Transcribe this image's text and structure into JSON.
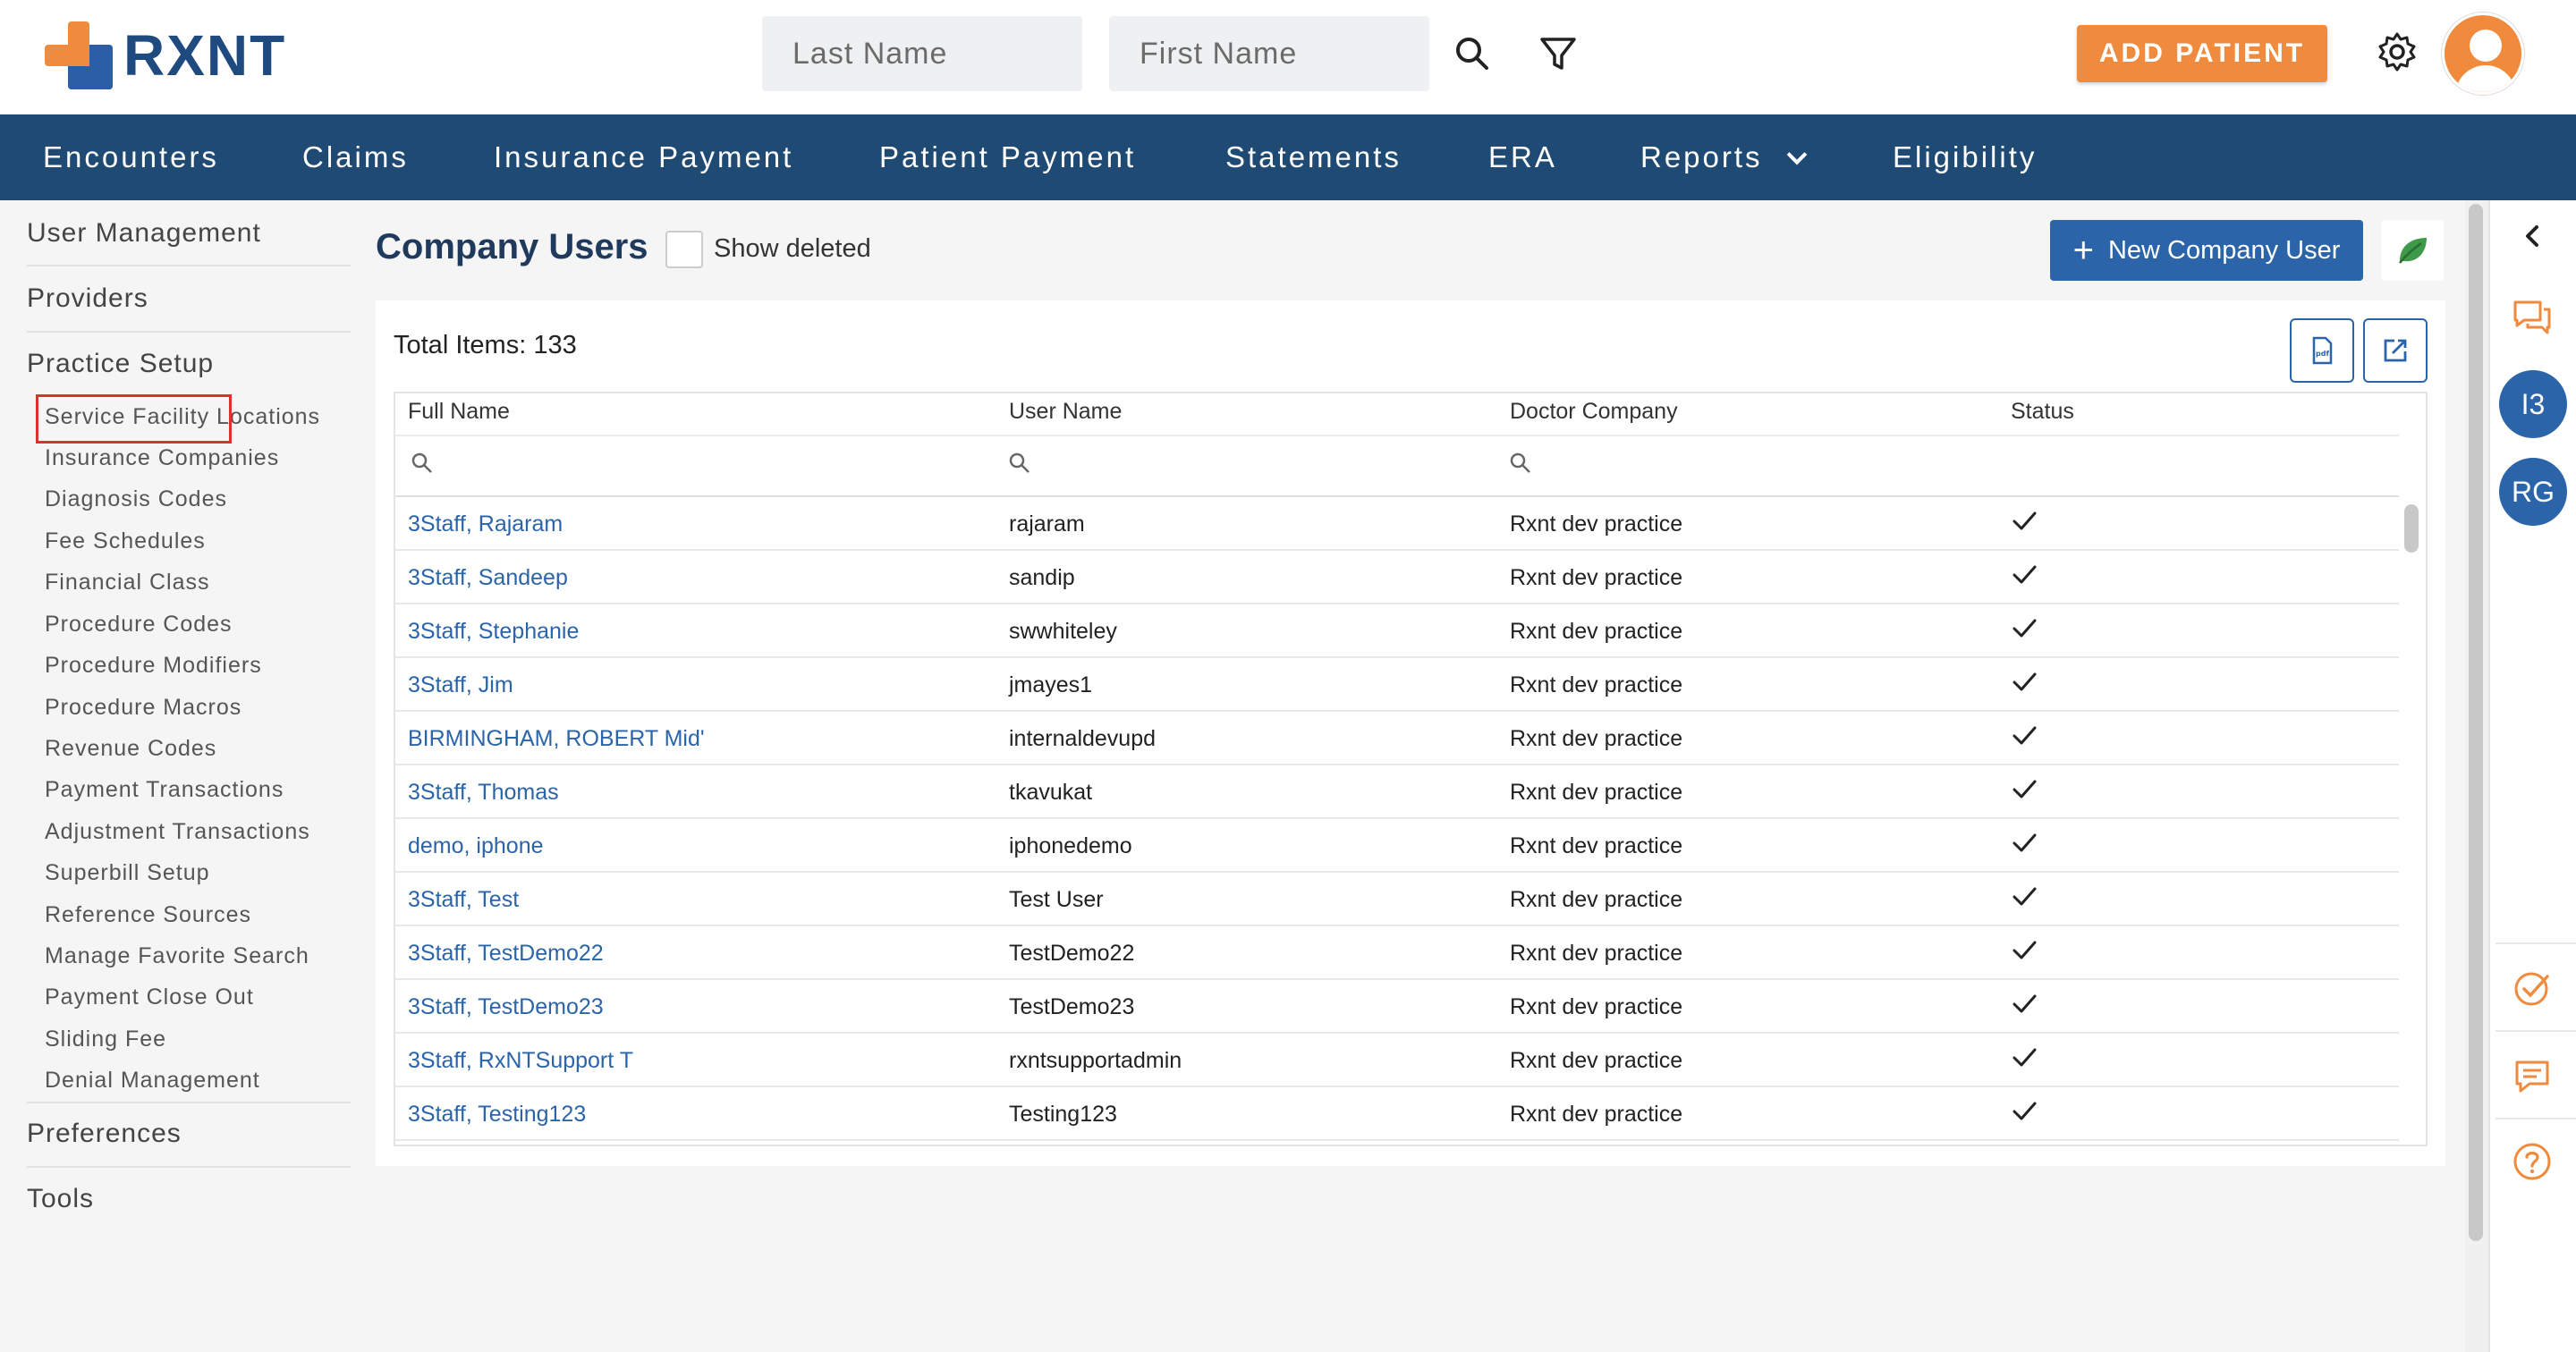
{
  "header": {
    "logo_text": "RXNT",
    "last_name_placeholder": "Last Name",
    "first_name_placeholder": "First Name",
    "add_patient_label": "ADD PATIENT"
  },
  "nav": {
    "items": [
      "Encounters",
      "Claims",
      "Insurance Payment",
      "Patient Payment",
      "Statements",
      "ERA",
      "Reports",
      "Eligibility"
    ]
  },
  "sidebar": {
    "sections": [
      "User Management",
      "Providers",
      "Practice Setup",
      "Preferences",
      "Tools"
    ],
    "practice_setup_items": [
      "Service Facility Locations",
      "Insurance Companies",
      "Diagnosis Codes",
      "Fee Schedules",
      "Financial Class",
      "Procedure Codes",
      "Procedure Modifiers",
      "Procedure Macros",
      "Revenue Codes",
      "Payment Transactions",
      "Adjustment Transactions",
      "Superbill Setup",
      "Reference Sources",
      "Manage Favorite Search",
      "Payment Close Out",
      "Sliding Fee",
      "Denial Management"
    ]
  },
  "main": {
    "title": "Company Users",
    "show_deleted_label": "Show deleted",
    "new_user_label": "New Company User",
    "total_items": "Total Items: 133"
  },
  "table": {
    "columns": [
      "Full Name",
      "User Name",
      "Doctor Company",
      "Status"
    ],
    "rows": [
      {
        "full_name": "3Staff, Rajaram",
        "user_name": "rajaram",
        "company": "Rxnt dev practice"
      },
      {
        "full_name": "3Staff, Sandeep",
        "user_name": "sandip",
        "company": "Rxnt dev practice"
      },
      {
        "full_name": "3Staff, Stephanie",
        "user_name": "swwhiteley",
        "company": "Rxnt dev practice"
      },
      {
        "full_name": "3Staff, Jim",
        "user_name": "jmayes1",
        "company": "Rxnt dev practice"
      },
      {
        "full_name": "BIRMINGHAM, ROBERT Mid'",
        "user_name": "internaldevupd",
        "company": "Rxnt dev practice"
      },
      {
        "full_name": "3Staff, Thomas",
        "user_name": "tkavukat",
        "company": "Rxnt dev practice"
      },
      {
        "full_name": "demo, iphone",
        "user_name": "iphonedemo",
        "company": "Rxnt dev practice"
      },
      {
        "full_name": "3Staff, Test",
        "user_name": "Test User",
        "company": "Rxnt dev practice"
      },
      {
        "full_name": "3Staff, TestDemo22",
        "user_name": "TestDemo22",
        "company": "Rxnt dev practice"
      },
      {
        "full_name": "3Staff, TestDemo23",
        "user_name": "TestDemo23",
        "company": "Rxnt dev practice"
      },
      {
        "full_name": "3Staff, RxNTSupport T",
        "user_name": "rxntsupportadmin",
        "company": "Rxnt dev practice"
      },
      {
        "full_name": "3Staff, Testing123",
        "user_name": "Testing123",
        "company": "Rxnt dev practice"
      }
    ]
  },
  "rail": {
    "badges": [
      "I3",
      "RG"
    ]
  },
  "colors": {
    "brand_orange": "#f08a3c",
    "brand_blue": "#1f4a73",
    "link_blue": "#2b64a8",
    "highlight_red": "#d9342b"
  }
}
